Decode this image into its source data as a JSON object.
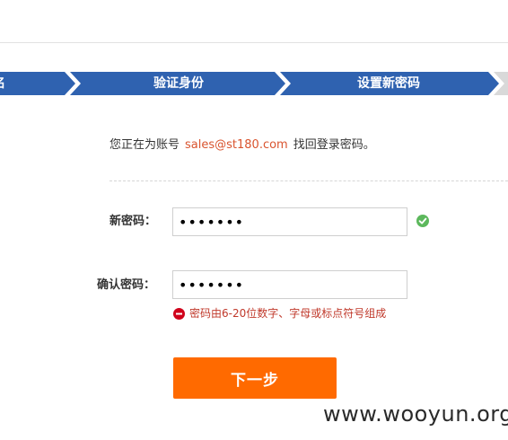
{
  "steps": [
    {
      "label": "名"
    },
    {
      "label": "验证身份"
    },
    {
      "label": "设置新密码"
    },
    {
      "label": ""
    }
  ],
  "account": {
    "prefix": "您正在为账号",
    "email": "sales@st180.com",
    "suffix": "找回登录密码。"
  },
  "form": {
    "new_password_label": "新密码：",
    "new_password_value": "1234567",
    "confirm_password_label": "确认密码：",
    "confirm_password_value": "1234567",
    "error_message": "密码由6-20位数字、字母或标点符号组成",
    "next_button": "下一步"
  },
  "watermark": "www.wooyun.org",
  "colors": {
    "step_active": "#2f62b0",
    "step_inactive": "#d9d9d9",
    "accent_orange": "#ff6a00",
    "success_green": "#5cb85c",
    "error_red": "#c0392b",
    "email_red": "#d9542f"
  },
  "icons": {
    "valid": "check-circle-icon",
    "error": "minus-circle-icon"
  }
}
